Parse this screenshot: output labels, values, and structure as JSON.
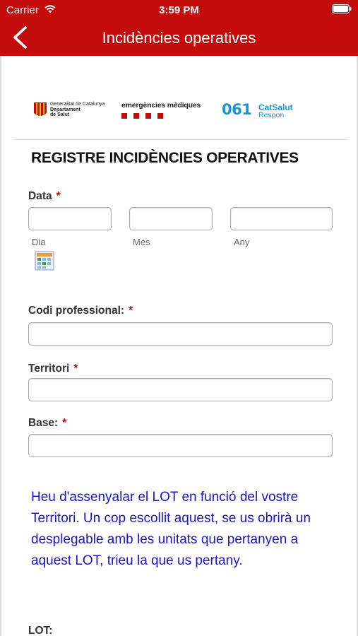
{
  "status_bar": {
    "carrier": "Carrier",
    "time": "3:59 PM",
    "wifi_icon": "wifi-icon",
    "battery_icon": "battery-icon"
  },
  "nav": {
    "title": "Incidències operatives",
    "back_icon": "chevron-left-icon",
    "background_color": "#c40c0c"
  },
  "logos": {
    "gencat": {
      "line1": "Generalitat de Catalunya",
      "line2": "Departament",
      "line3": "de Salut"
    },
    "sem": {
      "text": "emergències mèdiques"
    },
    "catsalut": {
      "number": "061",
      "brand": "CatSalut",
      "tagline": "Respon"
    }
  },
  "form": {
    "title": "REGISTRE INCIDÈNCIES OPERATIVES",
    "required_mark": "*",
    "date": {
      "label": "Data",
      "day_label": "Dia",
      "month_label": "Mes",
      "year_label": "Any",
      "day_value": "",
      "month_value": "",
      "year_value": "",
      "calendar_icon": "calendar-icon"
    },
    "professional_code": {
      "label": "Codi professional:",
      "value": ""
    },
    "territory": {
      "label": "Territori",
      "value": ""
    },
    "base": {
      "label": "Base:",
      "value": ""
    },
    "note": "Heu d'assenyalar el LOT en funció del vostre Territori. Un cop escollit aquest, se us obrirà un desplegable amb les unitats que pertanyen a aquest LOT, trieu la que us pertany.",
    "lot": {
      "label": "LOT:"
    }
  }
}
